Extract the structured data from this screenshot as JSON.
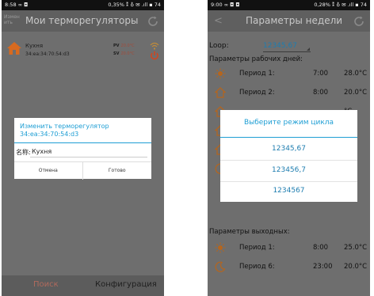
{
  "left": {
    "status": {
      "time": "8:58 ∞ ◘",
      "right": "0,35% ⁑ ♁ ✉ .ıll ▪ 74"
    },
    "actionbar": {
      "small_label": "Измен ить",
      "title": "Мои терморегуляторы"
    },
    "device": {
      "name": "Кухня",
      "mac": "34:ea:34:70:54:d3",
      "pv_label": "PV",
      "pv_value": "20.0°C",
      "sv_label": "SV",
      "sv_value": "20.0°C"
    },
    "dialog": {
      "title": "Изменить терморегулятор 34:ea:34:70:54:d3",
      "name_label": "名称:",
      "name_value": "Кухня",
      "cancel": "Отмена",
      "done": "Готово"
    },
    "bottom": {
      "search": "Поиск",
      "config": "Конфигурация"
    }
  },
  "right": {
    "status": {
      "time": "9:00 ∞ ◘ ◘",
      "right": "0,28% ⁑ ♁ ✉ .ıll ▪ 74"
    },
    "actionbar": {
      "back": "<",
      "title": "Параметры недели"
    },
    "loop": {
      "label": "Loop:",
      "value": "12345,67"
    },
    "workdays_heading": "Параметры рабочих дней:",
    "periods": [
      {
        "label": "Период 1:",
        "time": "7:00",
        "temp": "28.0°C"
      },
      {
        "label": "Период 2:",
        "time": "8:00",
        "temp": "20.0°C"
      },
      {
        "label": "",
        "time": "",
        "temp": "°C"
      },
      {
        "label": "",
        "time": "",
        "temp": "°C"
      },
      {
        "label": "",
        "time": "",
        "temp": "°C"
      },
      {
        "label": "",
        "time": "",
        "temp": "°C"
      }
    ],
    "weekend_heading": "Параметры выходных:",
    "weekend_periods": [
      {
        "label": "Период 1:",
        "time": "8:00",
        "temp": "25.0°C"
      },
      {
        "label": "Период 6:",
        "time": "23:00",
        "temp": "20.0°C"
      }
    ],
    "dialog": {
      "title": "Выберите режим цикла",
      "options": [
        "12345,67",
        "123456,7",
        "1234567"
      ]
    }
  },
  "colors": {
    "accent": "#1e9ed4",
    "accent_dark": "#1e7db0",
    "icon_orange": "#e0731e",
    "dim_bg": "#6e6e6e"
  }
}
